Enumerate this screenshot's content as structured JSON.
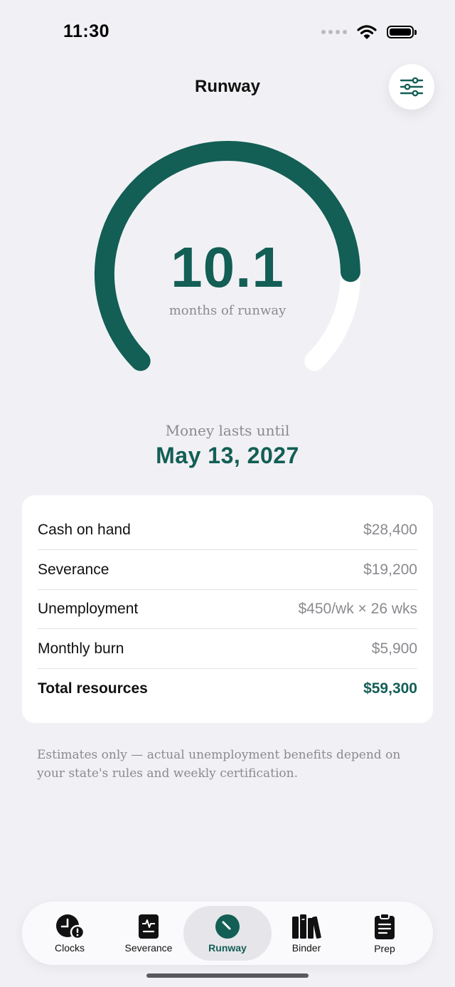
{
  "status_bar": {
    "time": "11:30"
  },
  "header": {
    "title": "Runway"
  },
  "gauge": {
    "value": "10.1",
    "caption": "months of runway",
    "fill_fraction": 0.83
  },
  "runout": {
    "label": "Money lasts until",
    "date": "May 13, 2027"
  },
  "summary": {
    "rows": [
      {
        "label": "Cash on hand",
        "value": "$28,400"
      },
      {
        "label": "Severance",
        "value": "$19,200"
      },
      {
        "label": "Unemployment",
        "value": "$450/wk × 26 wks"
      },
      {
        "label": "Monthly burn",
        "value": "$5,900"
      }
    ],
    "total": {
      "label": "Total resources",
      "value": "$59,300"
    }
  },
  "disclaimer": "Estimates only — actual unemployment benefits depend on your state's rules and weekly certification.",
  "tabs": [
    {
      "label": "Clocks",
      "icon": "clock-alert-icon"
    },
    {
      "label": "Severance",
      "icon": "document-pulse-icon"
    },
    {
      "label": "Runway",
      "icon": "gauge-icon",
      "active": true
    },
    {
      "label": "Binder",
      "icon": "books-icon"
    },
    {
      "label": "Prep",
      "icon": "clipboard-icon"
    }
  ],
  "colors": {
    "accent": "#135e55",
    "track": "#ffffff",
    "background": "#f1f1f5",
    "muted": "#8a8a8f"
  }
}
